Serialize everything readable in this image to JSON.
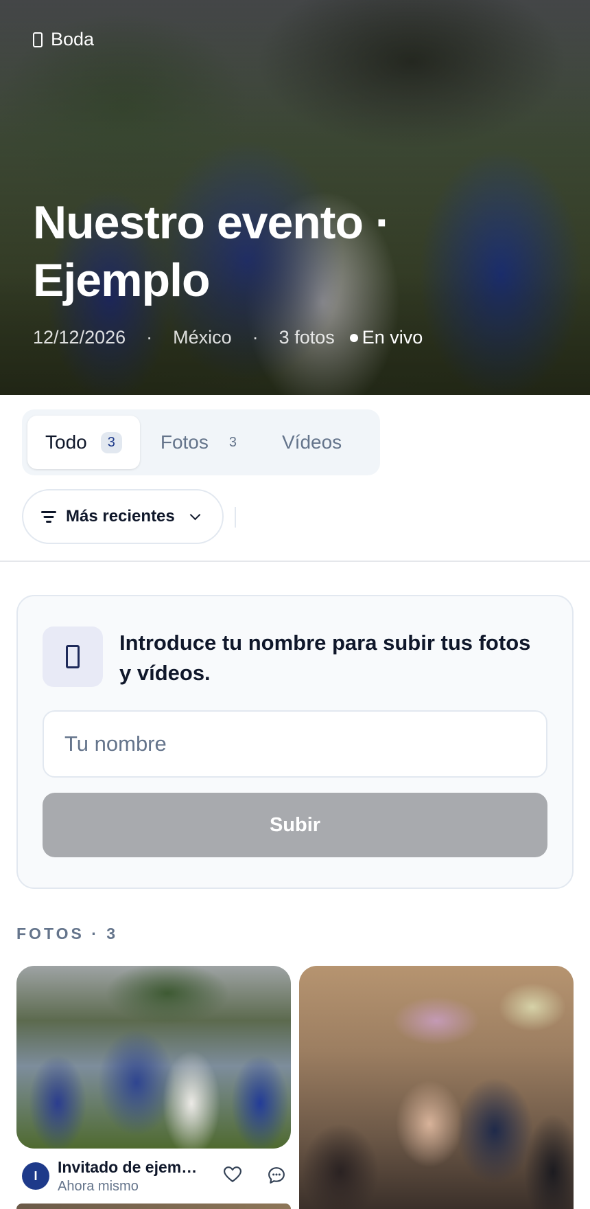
{
  "hero": {
    "category": "Boda",
    "category_icon": "door-icon",
    "title": "Nuestro evento · Ejemplo",
    "date": "12/12/2026",
    "separator": "·",
    "location": "México",
    "photo_count": "3 fotos",
    "status": "En vivo"
  },
  "tabs": [
    {
      "label": "Todo",
      "count": "3",
      "active": true
    },
    {
      "label": "Fotos",
      "count": "3",
      "active": false
    },
    {
      "label": "Vídeos",
      "count": "",
      "active": false
    }
  ],
  "sort": {
    "label": "Más recientes",
    "icon": "filter-icon"
  },
  "upload": {
    "icon": "door-icon",
    "prompt": "Introduce tu nombre para subir tus fotos y vídeos.",
    "name_placeholder": "Tu nombre",
    "name_value": "",
    "submit_label": "Subir"
  },
  "photos_section": {
    "title": "FOTOS · 3"
  },
  "photos": [
    {
      "author_initial": "I",
      "author": "Invitado de ejemplo",
      "time": "Ahora mismo"
    }
  ],
  "colors": {
    "accent": "#1e3a8a",
    "muted": "#64748b",
    "disabled_button": "#a8aaae",
    "card_bg": "#f8fafc"
  }
}
